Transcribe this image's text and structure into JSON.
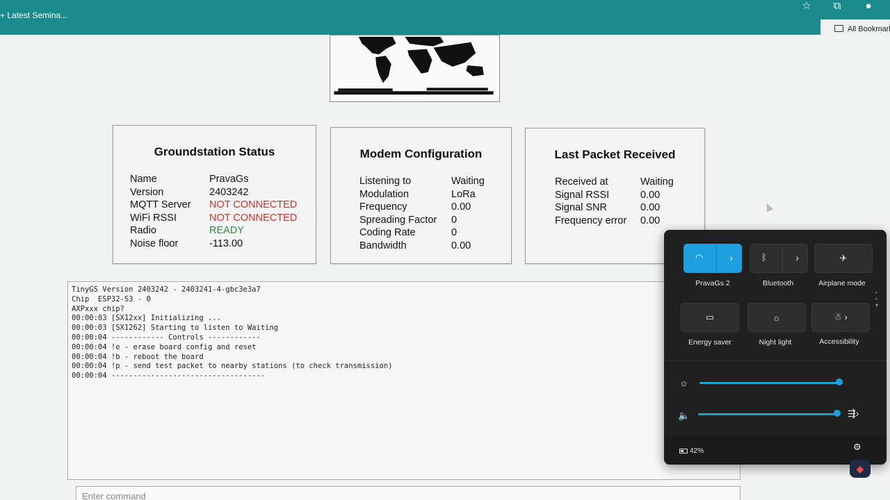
{
  "browser": {
    "tab_title": "+ Latest Semina...",
    "bookmarks_label": "All Bookmarks"
  },
  "status": {
    "title": "Groundstation Status",
    "rows": [
      {
        "key": "Name",
        "value": "PravaGs",
        "color": "#111111"
      },
      {
        "key": "Version",
        "value": "2403242",
        "color": "#111111"
      },
      {
        "key": "MQTT Server",
        "value": "NOT CONNECTED",
        "color": "#d0312d"
      },
      {
        "key": "WiFi RSSI",
        "value": "NOT CONNECTED",
        "color": "#d0312d"
      },
      {
        "key": "Radio",
        "value": "READY",
        "color": "#2e8b3a"
      },
      {
        "key": "Noise floor",
        "value": "-113.00",
        "color": "#111111"
      }
    ]
  },
  "modem": {
    "title": "Modem Configuration",
    "rows": [
      {
        "key": "Listening to",
        "value": "Waiting"
      },
      {
        "key": "Modulation",
        "value": "LoRa"
      },
      {
        "key": "Frequency",
        "value": "0.00"
      },
      {
        "key": "Spreading Factor",
        "value": "0"
      },
      {
        "key": "Coding Rate",
        "value": "0"
      },
      {
        "key": "Bandwidth",
        "value": "0.00"
      }
    ]
  },
  "packet": {
    "title": "Last Packet Received",
    "rows": [
      {
        "key": "Received at",
        "value": "Waiting"
      },
      {
        "key": "Signal RSSI",
        "value": "0.00"
      },
      {
        "key": "Signal SNR",
        "value": "0.00"
      },
      {
        "key": "Frequency error",
        "value": "0.00"
      }
    ]
  },
  "console": {
    "lines": [
      "TinyGS Version 2403242 - 2403241-4-gbc3e3a7",
      "Chip  ESP32-S3 - 0",
      "AXPxxx chip?",
      "00:00:03 [SX12xx] Initializing ...",
      "00:00:03 [SX1262] Starting to listen to Waiting",
      "00:00:04 ------------ Controls ------------",
      "00:00:04 !e - erase board config and reset",
      "00:00:04 !b - reboot the board",
      "00:00:04 !p - send test packet to nearby stations (to check transmission)",
      "00:00:04 -----------------------------------"
    ],
    "command_placeholder": "Enter command"
  },
  "quick_settings": {
    "tiles": [
      {
        "label": "PravaGs 2",
        "icon": "wifi-icon",
        "active": true
      },
      {
        "label": "Bluetooth",
        "icon": "bluetooth-icon",
        "active": false
      },
      {
        "label": "Airplane mode",
        "icon": "airplane-icon",
        "active": false
      },
      {
        "label": "Energy saver",
        "icon": "energy-saver-icon",
        "active": false
      },
      {
        "label": "Night light",
        "icon": "night-light-icon",
        "active": false
      },
      {
        "label": "Accessibility",
        "icon": "accessibility-icon",
        "active": false
      }
    ],
    "brightness_level": 1.0,
    "volume_level": 1.0,
    "battery": "42%",
    "accent_color": "#1e9fe0"
  }
}
